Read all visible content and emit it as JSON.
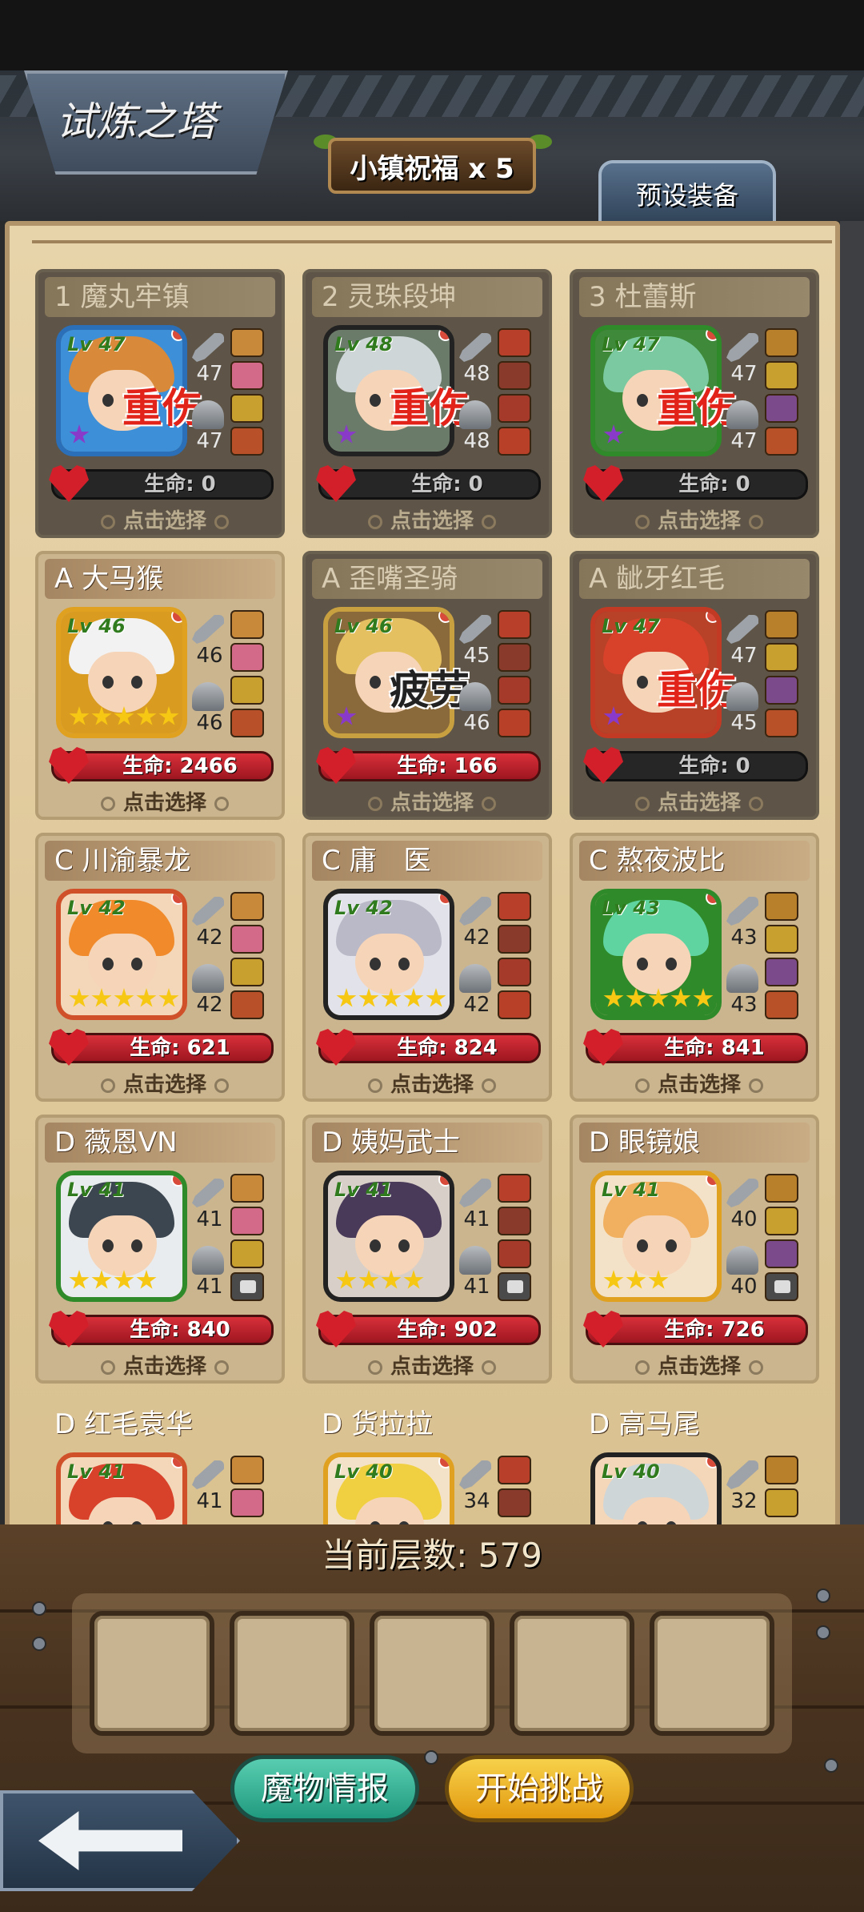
{
  "header": {
    "title": "试炼之塔",
    "blessing_label": "小镇祝福 x 5",
    "preset_tab": "预设装备"
  },
  "heroes": [
    {
      "name": "1 魔丸牢镇",
      "level": "Lv 47",
      "weapon": "47",
      "armor": "47",
      "hp": "生命: 0",
      "status": "重伤",
      "stars": 1,
      "select": "点击选择",
      "hair": "#d88a3a",
      "bg": "#3d8fd8",
      "frame": "#2a6fb8"
    },
    {
      "name": "2 灵珠段坤",
      "level": "Lv 48",
      "weapon": "48",
      "armor": "48",
      "hp": "生命: 0",
      "status": "重伤",
      "stars": 1,
      "select": "点击选择",
      "hair": "#cfd6d8",
      "bg": "#6a7b6a",
      "frame": "#222"
    },
    {
      "name": "3 杜蕾斯",
      "level": "Lv 47",
      "weapon": "47",
      "armor": "47",
      "hp": "生命: 0",
      "status": "重伤",
      "stars": 1,
      "select": "点击选择",
      "hair": "#7ac9a0",
      "bg": "#3f8a3a",
      "frame": "#2f8a2a"
    },
    {
      "name": "A 大马猴",
      "level": "Lv 46",
      "weapon": "46",
      "armor": "46",
      "hp": "生命: 2466",
      "status": "",
      "stars": 5,
      "select": "点击选择",
      "hair": "#f2f2f2",
      "bg": "#d99b20",
      "frame": "#e0a020"
    },
    {
      "name": "A 歪嘴圣骑",
      "level": "Lv 46",
      "weapon": "45",
      "armor": "46",
      "hp": "生命: 166",
      "status": "疲劳",
      "stars": 1,
      "select": "点击选择",
      "hair": "#e5c060",
      "bg": "#8a6a3a",
      "frame": "#c8a040"
    },
    {
      "name": "A 龇牙红毛",
      "level": "Lv 47",
      "weapon": "47",
      "armor": "45",
      "hp": "生命: 0",
      "status": "重伤",
      "stars": 1,
      "select": "点击选择",
      "hair": "#d8412a",
      "bg": "#b84228",
      "frame": "#c23a24"
    },
    {
      "name": "C 川渝暴龙",
      "level": "Lv 42",
      "weapon": "42",
      "armor": "42",
      "hp": "生命: 621",
      "status": "",
      "stars": 5,
      "select": "点击选择",
      "hair": "#f08a2a",
      "bg": "#f4d6b8",
      "frame": "#d0502a"
    },
    {
      "name": "C 庸　医",
      "level": "Lv 42",
      "weapon": "42",
      "armor": "42",
      "hp": "生命: 824",
      "status": "",
      "stars": 5,
      "select": "点击选择",
      "hair": "#b9b9c8",
      "bg": "#e2e2ea",
      "frame": "#222"
    },
    {
      "name": "C 熬夜波比",
      "level": "Lv 43",
      "weapon": "43",
      "armor": "43",
      "hp": "生命: 841",
      "status": "",
      "stars": 5,
      "select": "点击选择",
      "hair": "#5fd4a0",
      "bg": "#2f8a2a",
      "frame": "#2f8a2a"
    },
    {
      "name": "D  薇恩VN",
      "level": "Lv 41",
      "weapon": "41",
      "armor": "41",
      "hp": "生命: 840",
      "status": "",
      "stars": 4,
      "select": "点击选择",
      "hair": "#3c4650",
      "bg": "#e8ecee",
      "frame": "#2f8a2a"
    },
    {
      "name": "D 姨妈武士",
      "level": "Lv 41",
      "weapon": "41",
      "armor": "41",
      "hp": "生命: 902",
      "status": "",
      "stars": 4,
      "select": "点击选择",
      "hair": "#4a3a5a",
      "bg": "#d8d0c8",
      "frame": "#222"
    },
    {
      "name": "D 眼镜娘",
      "level": "Lv 41",
      "weapon": "40",
      "armor": "40",
      "hp": "生命: 726",
      "status": "",
      "stars": 3,
      "select": "点击选择",
      "hair": "#f0b060",
      "bg": "#f4e2c8",
      "frame": "#e0a020"
    },
    {
      "name": "D 红毛袁华",
      "level": "Lv 41",
      "weapon": "41",
      "armor": "",
      "hp": "",
      "status": "",
      "stars": 0,
      "select": "",
      "hair": "#d8412a",
      "bg": "#f4d6b8",
      "frame": "#d0502a"
    },
    {
      "name": "D 货拉拉",
      "level": "Lv 40",
      "weapon": "34",
      "armor": "",
      "hp": "",
      "status": "",
      "stars": 0,
      "select": "",
      "hair": "#f0d040",
      "bg": "#f4e2c8",
      "frame": "#e0a020"
    },
    {
      "name": "D 高马尾",
      "level": "Lv 40",
      "weapon": "32",
      "armor": "",
      "hp": "",
      "status": "",
      "stars": 0,
      "select": "",
      "hair": "#cfd6d8",
      "bg": "#f4d6b8",
      "frame": "#222"
    }
  ],
  "footer": {
    "floor_label": "当前层数: 579",
    "team_slots": 5,
    "info_button": "魔物情报",
    "start_button": "开始挑战"
  },
  "colors": {
    "panel": "#e8d4aa",
    "hp_red": "#d8303a",
    "status_red": "#e2231a",
    "accent_green": "#2f7b1d"
  }
}
